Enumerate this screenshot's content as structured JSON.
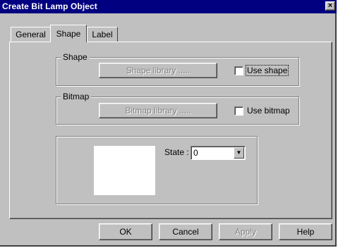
{
  "dialog": {
    "title": "Create Bit Lamp Object",
    "close_glyph": "×"
  },
  "tabs": [
    {
      "label": "General",
      "active": false
    },
    {
      "label": "Shape",
      "active": true
    },
    {
      "label": "Label",
      "active": false
    }
  ],
  "shape_group": {
    "title": "Shape",
    "library_button": "Shape library .....",
    "checkbox_label": "Use shape",
    "checked": false
  },
  "bitmap_group": {
    "title": "Bitmap",
    "library_button": "Bitmap library .....",
    "checkbox_label": "Use bitmap",
    "checked": false
  },
  "state": {
    "label": "State :",
    "value": "0"
  },
  "buttons": {
    "ok": "OK",
    "cancel": "Cancel",
    "apply": "Apply",
    "help": "Help"
  },
  "icons": {
    "close": "close-icon",
    "dropdown": "chevron-down-icon"
  },
  "colors": {
    "titlebar": "#000080",
    "face": "#c0c0c0"
  }
}
